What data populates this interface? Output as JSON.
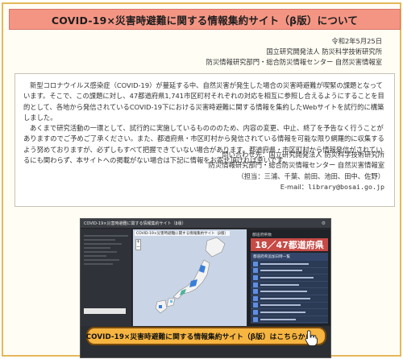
{
  "page": {
    "title": "COVID-19×災害時避難に関する情報集約サイト（β版）について"
  },
  "meta": {
    "date": "令和2年5月25日",
    "org_line1": "国立研究開発法人 防災科学技術研究所",
    "org_line2": "防災情報研究部門・総合防災情報センター 自然災害情報室"
  },
  "notice": {
    "paragraphs": [
      "新型コロナウイルス感染症（COVID-19）が蔓延する中、自然災害が発生した場合の災害時避難が喫緊の課題となっています。そこで、この課題に対し、47都道府県1,741市区町村それぞれの対応を相互に参照し合えるようにすることを目的として、各地から発信されているCOVID-19下における災害時避難に関する情報を集約したWebサイトを試行的に構築しました。",
      "あくまで研究活動の一環として、試行的に実施しているものののため、内容の変更、中止、終了を予告なく行うことがありますのでご予めご了承ください。また、都道府県・市区町村から発信されている情報を可能な限り網羅的に収集するよう努めておりますが、必ずしもすべて把握できていない場合があります。都道府県・市区町村から情報発信がされているにも関わらず、本サイトへの掲載がない場合は下記に情報をお寄せ頂ければ幸いです。"
    ],
    "contact": {
      "line1": "問い合わせ先：国立研究開発法人 防災科学技術研究所",
      "line2": "防災情報研究部門・総合防災情報センター 自然災害情報室",
      "line3": "（担当：三浦、千葉、前田、池田、田中、佐野）",
      "email_label": "E-mail：",
      "email": "library@bosai.go.jp"
    }
  },
  "banner": {
    "header_text": "COVID-19×災害時避難に関する情報集約サイト（β版）",
    "map_caption": "COVID-19×災害時避難に関する情報集約サイト（β版）",
    "counter_caption": "都道府県数",
    "counter": "18／47都道府県",
    "list_caption": "都道府県追加日時一覧",
    "cta_label": "COVID-19×災害時避難に関する情報集約サイト（β版）はこちらから"
  },
  "colors": {
    "title_bg": "#f49584",
    "frame_border": "#e4b85a",
    "counter_bg": "#c64a45",
    "cta_bg": "#f6b440"
  }
}
